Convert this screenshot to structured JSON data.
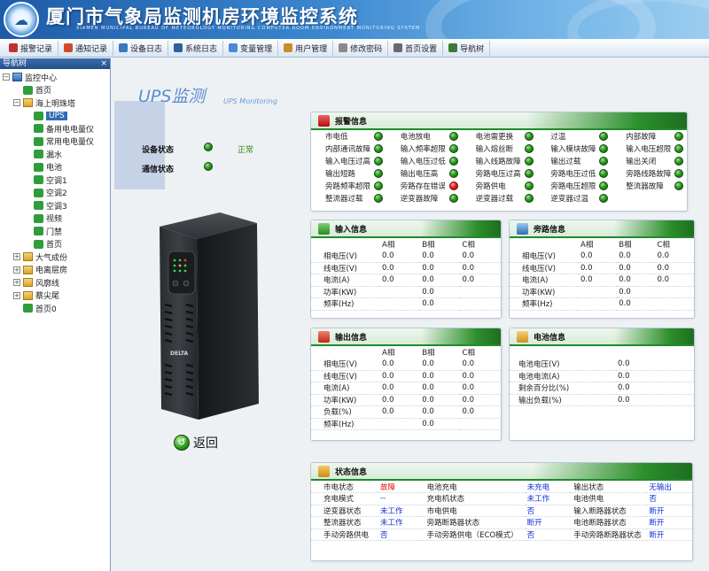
{
  "header": {
    "title": "厦门市气象局监测机房环境监控系统",
    "subtitle": "XIAMEN MUNICIPAL BUREAU OF METEOROLOGY MONITORING COMPUTER ROOM ENVIRONMENT MONITORING SYSTEM"
  },
  "menu": [
    {
      "label": "报警记录",
      "icon": "alarm-record-icon",
      "color": "#c23030"
    },
    {
      "label": "通知记录",
      "icon": "notice-record-icon",
      "color": "#d04a2a"
    },
    {
      "label": "设备日志",
      "icon": "device-log-icon",
      "color": "#3a77c0"
    },
    {
      "label": "系统日志",
      "icon": "system-log-icon",
      "color": "#2f5f9a"
    },
    {
      "label": "变量管理",
      "icon": "variable-icon",
      "color": "#4c8ad0"
    },
    {
      "label": "用户管理",
      "icon": "user-icon",
      "color": "#d08a2a"
    },
    {
      "label": "修改密码",
      "icon": "password-icon",
      "color": "#8a8a8a"
    },
    {
      "label": "首页设置",
      "icon": "home-settings-icon",
      "color": "#6a6a6a"
    },
    {
      "label": "导航树",
      "icon": "nav-tree-icon",
      "color": "#3a7a3a"
    }
  ],
  "sidebar": {
    "title": "导航树",
    "close": "×",
    "nodes": [
      {
        "label": "监控中心",
        "level": 0,
        "toggle": "−",
        "icon": "monitor"
      },
      {
        "label": "首页",
        "level": 1,
        "toggle": "",
        "icon": "leaf"
      },
      {
        "label": "海上明珠塔",
        "level": 1,
        "toggle": "−",
        "icon": "folder"
      },
      {
        "label": "UPS",
        "level": 2,
        "toggle": "",
        "icon": "leaf",
        "selected": true
      },
      {
        "label": "备用电电量仪",
        "level": 2,
        "toggle": "",
        "icon": "leaf"
      },
      {
        "label": "常用电电量仪",
        "level": 2,
        "toggle": "",
        "icon": "leaf"
      },
      {
        "label": "漏水",
        "level": 2,
        "toggle": "",
        "icon": "leaf"
      },
      {
        "label": "电池",
        "level": 2,
        "toggle": "",
        "icon": "leaf"
      },
      {
        "label": "空调1",
        "level": 2,
        "toggle": "",
        "icon": "leaf"
      },
      {
        "label": "空调2",
        "level": 2,
        "toggle": "",
        "icon": "leaf"
      },
      {
        "label": "空调3",
        "level": 2,
        "toggle": "",
        "icon": "leaf"
      },
      {
        "label": "视频",
        "level": 2,
        "toggle": "",
        "icon": "leaf"
      },
      {
        "label": "门禁",
        "level": 2,
        "toggle": "",
        "icon": "leaf"
      },
      {
        "label": "首页",
        "level": 2,
        "toggle": "",
        "icon": "leaf"
      },
      {
        "label": "大气成份",
        "level": 1,
        "toggle": "+",
        "icon": "folder"
      },
      {
        "label": "电离层房",
        "level": 1,
        "toggle": "+",
        "icon": "folder"
      },
      {
        "label": "风廓线",
        "level": 1,
        "toggle": "+",
        "icon": "folder"
      },
      {
        "label": "蔡尖尾",
        "level": 1,
        "toggle": "+",
        "icon": "folder"
      },
      {
        "label": "首页0",
        "level": 1,
        "toggle": "",
        "icon": "leaf"
      }
    ]
  },
  "page": {
    "title": "UPS监测",
    "subtitle": "UPS Monitoring",
    "device_status_label": "设备状态",
    "device_status_value": "正常",
    "comm_status_label": "通信状态",
    "return_label": "返回",
    "brand": "DELTA"
  },
  "alarm": {
    "title": "报警信息",
    "rows": [
      [
        {
          "label": "市电低",
          "state": "ok"
        },
        {
          "label": "电池放电",
          "state": "ok"
        },
        {
          "label": "电池需更换",
          "state": "ok"
        },
        {
          "label": "过温",
          "state": "ok"
        },
        {
          "label": "内部故障",
          "state": "ok"
        }
      ],
      [
        {
          "label": "内部通讯故障",
          "state": "ok"
        },
        {
          "label": "输入频率超限",
          "state": "ok"
        },
        {
          "label": "输入熔丝断",
          "state": "ok"
        },
        {
          "label": "输入模块故障",
          "state": "ok"
        },
        {
          "label": "输入电压超限",
          "state": "ok"
        }
      ],
      [
        {
          "label": "输入电压过高",
          "state": "ok"
        },
        {
          "label": "输入电压过低",
          "state": "ok"
        },
        {
          "label": "输入线路故障",
          "state": "ok"
        },
        {
          "label": "输出过载",
          "state": "ok"
        },
        {
          "label": "输出关闭",
          "state": "ok"
        }
      ],
      [
        {
          "label": "输出短路",
          "state": "ok"
        },
        {
          "label": "输出电压高",
          "state": "ok"
        },
        {
          "label": "旁路电压过高",
          "state": "ok"
        },
        {
          "label": "旁路电压过低",
          "state": "ok"
        },
        {
          "label": "旁路线路故障",
          "state": "ok"
        }
      ],
      [
        {
          "label": "旁路频率超限",
          "state": "ok"
        },
        {
          "label": "旁路存在错误",
          "state": "alarm"
        },
        {
          "label": "旁路供电",
          "state": "ok"
        },
        {
          "label": "旁路电压超限",
          "state": "ok"
        },
        {
          "label": "整流器故障",
          "state": "ok"
        }
      ],
      [
        {
          "label": "整流器过载",
          "state": "ok"
        },
        {
          "label": "逆变器故障",
          "state": "ok"
        },
        {
          "label": "逆变器过载",
          "state": "ok"
        },
        {
          "label": "逆变器过温",
          "state": "ok"
        },
        {
          "label": "",
          "state": ""
        }
      ]
    ]
  },
  "input": {
    "title": "输入信息",
    "cols": [
      "A相",
      "B相",
      "C相"
    ],
    "rows": [
      {
        "label": "相电压(V)",
        "values": [
          "0.0",
          "0.0",
          "0.0"
        ]
      },
      {
        "label": "线电压(V)",
        "values": [
          "0.0",
          "0.0",
          "0.0"
        ]
      },
      {
        "label": "电流(A)",
        "values": [
          "0.0",
          "0.0",
          "0.0"
        ]
      },
      {
        "label": "功率(KW)",
        "values": [
          "",
          "0.0",
          ""
        ]
      },
      {
        "label": "频率(Hz)",
        "values": [
          "",
          "0.0",
          ""
        ]
      }
    ]
  },
  "bypass": {
    "title": "旁路信息",
    "cols": [
      "A相",
      "B相",
      "C相"
    ],
    "rows": [
      {
        "label": "相电压(V)",
        "values": [
          "0.0",
          "0.0",
          "0.0"
        ]
      },
      {
        "label": "线电压(V)",
        "values": [
          "0.0",
          "0.0",
          "0.0"
        ]
      },
      {
        "label": "电流(A)",
        "values": [
          "0.0",
          "0.0",
          "0.0"
        ]
      },
      {
        "label": "功率(KW)",
        "values": [
          "",
          "0.0",
          ""
        ]
      },
      {
        "label": "频率(Hz)",
        "values": [
          "",
          "0.0",
          ""
        ]
      }
    ]
  },
  "output": {
    "title": "输出信息",
    "cols": [
      "A相",
      "B相",
      "C相"
    ],
    "rows": [
      {
        "label": "相电压(V)",
        "values": [
          "0.0",
          "0.0",
          "0.0"
        ]
      },
      {
        "label": "线电压(V)",
        "values": [
          "0.0",
          "0.0",
          "0.0"
        ]
      },
      {
        "label": "电流(A)",
        "values": [
          "0.0",
          "0.0",
          "0.0"
        ]
      },
      {
        "label": "功率(KW)",
        "values": [
          "0.0",
          "0.0",
          "0.0"
        ]
      },
      {
        "label": "负载(%)",
        "values": [
          "0.0",
          "0.0",
          "0.0"
        ]
      },
      {
        "label": "频率(Hz)",
        "values": [
          "",
          "0.0",
          ""
        ]
      }
    ]
  },
  "battery": {
    "title": "电池信息",
    "rows": [
      {
        "label": "电池电压(V)",
        "value": "0.0"
      },
      {
        "label": "电池电流(A)",
        "value": "0.0"
      },
      {
        "label": "剩余百分比(%)",
        "value": "0.0"
      },
      {
        "label": "输出负载(%)",
        "value": "0.0"
      }
    ]
  },
  "status": {
    "title": "状态信息",
    "rows": [
      [
        {
          "label": "市电状态",
          "value": "故障",
          "color": "red"
        },
        {
          "label": "电池充电",
          "value": "未充电",
          "color": "blue"
        },
        {
          "label": "输出状态",
          "value": "无输出",
          "color": "blue"
        }
      ],
      [
        {
          "label": "充电模式",
          "value": "--",
          "color": "blue"
        },
        {
          "label": "充电机状态",
          "value": "未工作",
          "color": "blue"
        },
        {
          "label": "电池供电",
          "value": "否",
          "color": "blue"
        }
      ],
      [
        {
          "label": "逆变器状态",
          "value": "未工作",
          "color": "blue"
        },
        {
          "label": "市电供电",
          "value": "否",
          "color": "blue"
        },
        {
          "label": "输入断路器状态",
          "value": "断开",
          "color": "blue"
        }
      ],
      [
        {
          "label": "整流器状态",
          "value": "未工作",
          "color": "blue"
        },
        {
          "label": "旁路断路器状态",
          "value": "断开",
          "color": "blue"
        },
        {
          "label": "电池断路器状态",
          "value": "断开",
          "color": "blue"
        }
      ],
      [
        {
          "label": "手动旁路供电",
          "value": "否",
          "color": "blue"
        },
        {
          "label": "手动旁路供电（ECO模式）",
          "value": "否",
          "color": "blue"
        },
        {
          "label": "手动旁路断路器状态",
          "value": "断开",
          "color": "blue"
        }
      ]
    ]
  }
}
